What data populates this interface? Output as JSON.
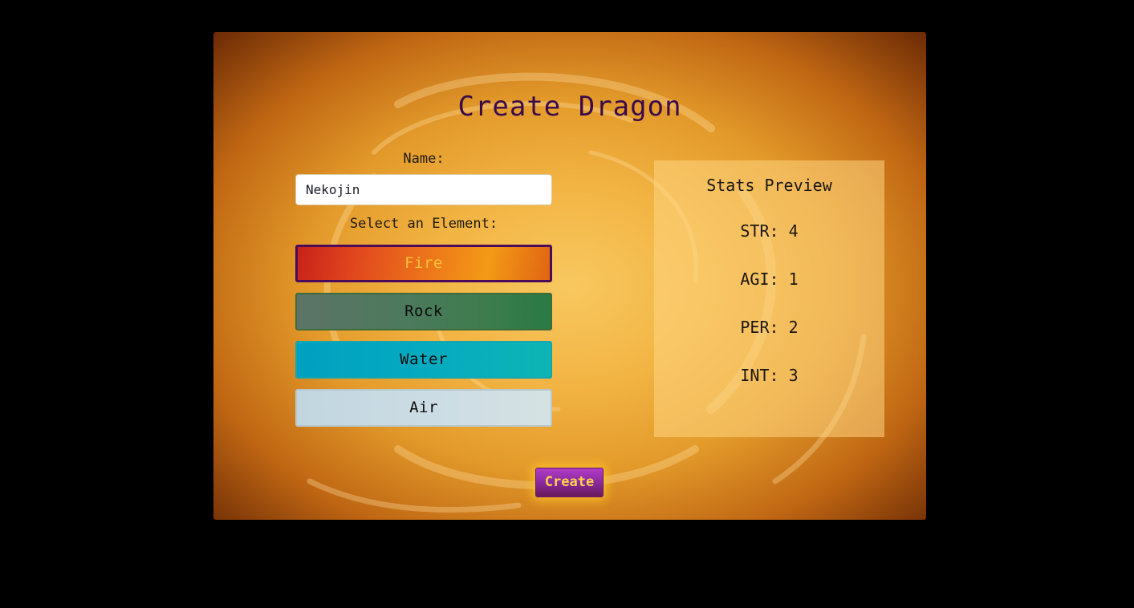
{
  "screen": {
    "title": "Create Dragon"
  },
  "form": {
    "name_label": "Name:",
    "name_value": "Nekojin",
    "element_label": "Select an Element:",
    "elements": [
      {
        "label": "Fire",
        "selected": true
      },
      {
        "label": "Rock",
        "selected": false
      },
      {
        "label": "Water",
        "selected": false
      },
      {
        "label": "Air",
        "selected": false
      }
    ],
    "create_label": "Create"
  },
  "stats": {
    "title": "Stats Preview",
    "items": [
      {
        "text": "STR: 4"
      },
      {
        "text": "AGI: 1"
      },
      {
        "text": "PER: 2"
      },
      {
        "text": "INT: 3"
      }
    ]
  },
  "colors": {
    "page_background": "#000000",
    "title": "#3a0a4a",
    "fire": "#ee7b1a",
    "rock": "#3d7c4d",
    "water": "#05aac0",
    "air": "#cddde4",
    "create_button": "#8a2aa0",
    "create_text": "#ffd34a"
  }
}
